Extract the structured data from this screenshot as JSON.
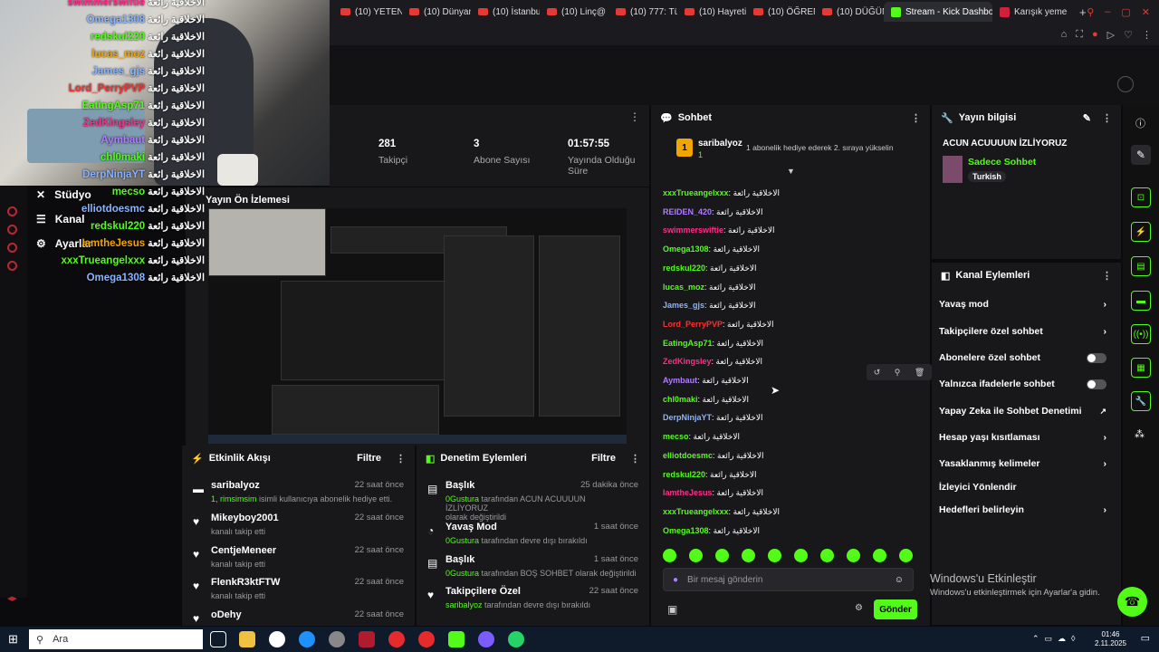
{
  "browser": {
    "tabs": [
      "(10) YETENE",
      "(10) Dünyan",
      "(10) İstanbu",
      "(10) Linç@",
      "(10) 777: Tü",
      "(10) Hayreti",
      "(10) ÖĞREN",
      "(10) DÜĞÜN"
    ],
    "active_tab": "Stream - Kick Dashbo",
    "last_tab": "Karışık yeme"
  },
  "overlay": {
    "users": [
      {
        "name": "swimmerswiftie",
        "color": "#ff2e88",
        "msg": "الاخلاقية رائعة"
      },
      {
        "name": "Omega1308",
        "color": "#8ab4ff",
        "msg": "الاخلاقية رائعة"
      },
      {
        "name": "redskul220",
        "color": "#53fc18",
        "msg": "الاخلاقية رائعة"
      },
      {
        "name": "lucas_moz",
        "color": "#f0a500",
        "msg": "الاخلاقية رائعة"
      },
      {
        "name": "James_gjs",
        "color": "#8ab4ff",
        "msg": "الاخلاقية رائعة"
      },
      {
        "name": "Lord_PerryPVP",
        "color": "#ff2e2e",
        "msg": "الاخلاقية رائعة"
      },
      {
        "name": "EatingAsp71",
        "color": "#53fc18",
        "msg": "الاخلاقية رائعة"
      },
      {
        "name": "ZedKingsley",
        "color": "#ff2e88",
        "msg": "الاخلاقية رائعة"
      },
      {
        "name": "Aymbaut",
        "color": "#b07cff",
        "msg": "الاخلاقية رائعة"
      },
      {
        "name": "chl0maki",
        "color": "#53fc18",
        "msg": "الاخلاقية رائعة"
      },
      {
        "name": "DerpNinjaYT",
        "color": "#8ab4ff",
        "msg": "الاخلاقية رائعة"
      },
      {
        "name": "mecso",
        "color": "#53fc18",
        "msg": "الاخلاقية رائعة"
      },
      {
        "name": "elliotdoesmc",
        "color": "#8ab4ff",
        "msg": "الاخلاقية رائعة"
      },
      {
        "name": "redskul220",
        "color": "#53fc18",
        "msg": "الاخلاقية رائعة"
      },
      {
        "name": "IamtheJesus",
        "color": "#f0a500",
        "msg": "الاخلاقية رائعة"
      },
      {
        "name": "xxxTrueangelxxx",
        "color": "#53fc18",
        "msg": "الاخلاقية رائعة"
      },
      {
        "name": "Omega1308",
        "color": "#8ab4ff",
        "msg": "الاخلاقية رائعة"
      }
    ]
  },
  "nav": {
    "studio": "Stüdyo",
    "channel": "Kanal",
    "settings": "Ayarlar"
  },
  "stats": [
    {
      "value": "281",
      "label": "Takipçi"
    },
    {
      "value": "3",
      "label": "Abone Sayısı"
    },
    {
      "value": "01:57:55",
      "label": "Yayında Olduğu Süre"
    }
  ],
  "preview": {
    "title": "Yayın Ön İzlemesi"
  },
  "activity": {
    "title": "Etkinlik Akışı",
    "filter": "Filtre",
    "items": [
      {
        "name": "saribalyoz",
        "sub_user": "1, rimsimsim",
        "sub_text": "isimli kullanıcıya abonelik hediye etti.",
        "time": "22 saat önce"
      },
      {
        "name": "Mikeyboy2001",
        "sub": "kanalı takip etti",
        "time": "22 saat önce"
      },
      {
        "name": "CentjeMeneer",
        "sub": "kanalı takip etti",
        "time": "22 saat önce"
      },
      {
        "name": "FlenkR3ktFTW",
        "sub": "kanalı takip etti",
        "time": "22 saat önce"
      },
      {
        "name": "oDehy",
        "sub": "",
        "time": "22 saat önce"
      }
    ]
  },
  "moderation": {
    "title": "Denetim Eylemleri",
    "filter": "Filtre",
    "items": [
      {
        "name": "Başlık",
        "actor": "0Gustura",
        "text": "tarafından ACUN ACUUUUN İZLİYORUZ",
        "text2": "olarak değiştirildi",
        "time": "25 dakika önce"
      },
      {
        "name": "Yavaş Mod",
        "actor": "0Gustura",
        "text": "tarafından devre dışı bırakıldı",
        "time": "1 saat önce"
      },
      {
        "name": "Başlık",
        "actor": "0Gustura",
        "text": "tarafından BOŞ SOHBET olarak değiştirildi",
        "time": "1 saat önce"
      },
      {
        "name": "Takipçilere Özel",
        "actor": "saribalyoz",
        "text": "tarafından devre dışı bırakıldı",
        "time": "22 saat önce"
      }
    ]
  },
  "chat": {
    "title": "Sohbet",
    "pinned_user": "saribalyoz",
    "pinned_count": "1",
    "pinned_text": "1 abonelik hediye ederek 2. sıraya yükselin",
    "messages": [
      {
        "name": "xxxTrueangelxxx",
        "color": "#53fc18",
        "msg": "الاخلاقية رائعة"
      },
      {
        "name": "REIDEN_420",
        "color": "#b07cff",
        "msg": "الاخلاقية رائعة"
      },
      {
        "name": "swimmerswiftie",
        "color": "#ff2e88",
        "msg": "الاخلاقية رائعة"
      },
      {
        "name": "Omega1308",
        "color": "#53fc18",
        "msg": "الاخلاقية رائعة"
      },
      {
        "name": "redskul220",
        "color": "#53fc18",
        "msg": "الاخلاقية رائعة"
      },
      {
        "name": "lucas_moz",
        "color": "#53fc18",
        "msg": "الاخلاقية رائعة"
      },
      {
        "name": "James_gjs",
        "color": "#8ab4ff",
        "msg": "الاخلاقية رائعة"
      },
      {
        "name": "Lord_PerryPVP",
        "color": "#ff2e2e",
        "msg": "الاخلاقية رائعة"
      },
      {
        "name": "EatingAsp71",
        "color": "#53fc18",
        "msg": "الاخلاقية رائعة"
      },
      {
        "name": "ZedKingsley",
        "color": "#ff2e88",
        "msg": "الاخلاقية رائعة"
      },
      {
        "name": "Aymbaut",
        "color": "#b07cff",
        "msg": "الاخلاقية رائعة"
      },
      {
        "name": "chl0maki",
        "color": "#53fc18",
        "msg": "الاخلاقية رائعة"
      },
      {
        "name": "DerpNinjaYT",
        "color": "#8ab4ff",
        "msg": "الاخلاقية رائعة"
      },
      {
        "name": "mecso",
        "color": "#53fc18",
        "msg": "الاخلاقية رائعة"
      },
      {
        "name": "elliotdoesmc",
        "color": "#53fc18",
        "msg": "الاخلاقية رائعة"
      },
      {
        "name": "redskul220",
        "color": "#53fc18",
        "msg": "الاخلاقية رائعة"
      },
      {
        "name": "IamtheJesus",
        "color": "#ff2e88",
        "msg": "الاخلاقية رائعة"
      },
      {
        "name": "xxxTrueangelxxx",
        "color": "#53fc18",
        "msg": "الاخلاقية رائعة"
      },
      {
        "name": "Omega1308",
        "color": "#53fc18",
        "msg": "الاخلاقية رائعة"
      }
    ],
    "input_placeholder": "Bir mesaj gönderin",
    "send": "Gönder"
  },
  "stream_info": {
    "title": "Yayın bilgisi",
    "stream_title": "ACUN ACUUUUN İZLİYORUZ",
    "category": "Sadece Sohbet",
    "language": "Turkish"
  },
  "channel_actions": {
    "title": "Kanal Eylemleri",
    "items": [
      {
        "label": "Yavaş mod",
        "type": "arrow"
      },
      {
        "label": "Takipçilere özel sohbet",
        "type": "arrow"
      },
      {
        "label": "Abonelere özel sohbet",
        "type": "toggle"
      },
      {
        "label": "Yalnızca ifadelerle sohbet",
        "type": "toggle"
      },
      {
        "label": "Yapay Zeka ile Sohbet Denetimi",
        "type": "ext"
      },
      {
        "label": "Hesap yaşı kısıtlaması",
        "type": "arrow"
      },
      {
        "label": "Yasaklanmış kelimeler",
        "type": "arrow"
      },
      {
        "label": "İzleyici Yönlendir",
        "type": "none"
      },
      {
        "label": "Hedefleri belirleyin",
        "type": "arrow"
      }
    ]
  },
  "windows": {
    "activate_title": "Windows'u Etkinleştir",
    "activate_text": "Windows'u etkinleştirmek için Ayarlar'a gidin.",
    "search": "Ara",
    "time": "01:46",
    "date": "2.11.2025"
  },
  "colors": {
    "accent": "#53fc18",
    "panel": "#18181b"
  }
}
